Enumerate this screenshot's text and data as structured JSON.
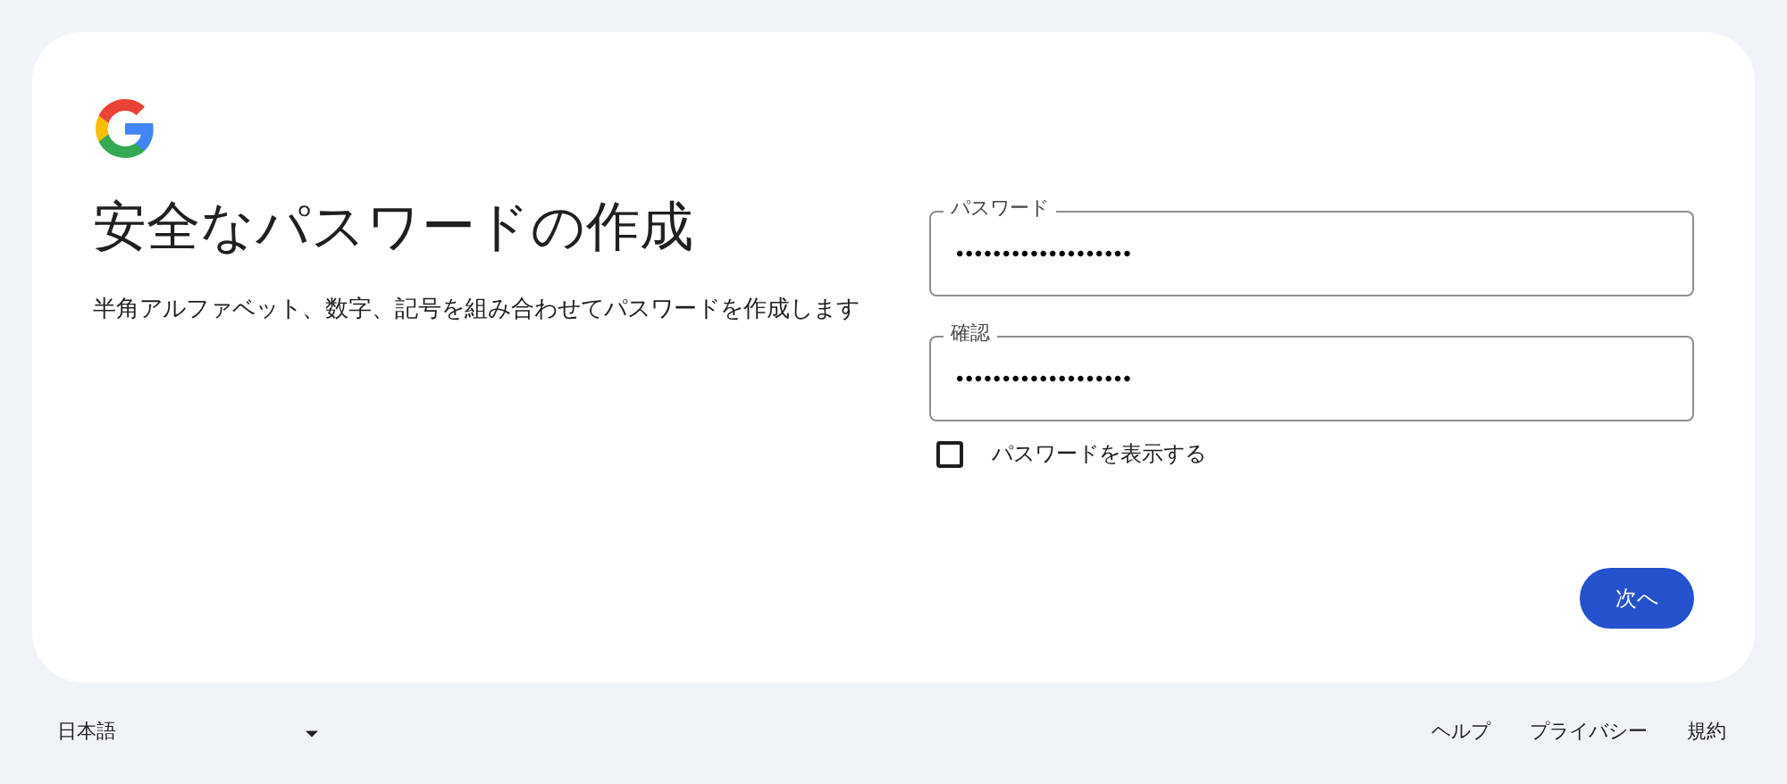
{
  "title": "安全なパスワードの作成",
  "description": "半角アルファベット、数字、記号を組み合わせてパスワードを作成します",
  "fields": [
    {
      "label": "パスワード",
      "value": "•••••••••••••••••••"
    },
    {
      "label": "確認",
      "value": "•••••••••••••••••••"
    }
  ],
  "show_password": {
    "label": "パスワードを表示する",
    "checked": false
  },
  "next_button": "次へ",
  "footer": {
    "language": "日本語",
    "links": [
      "ヘルプ",
      "プライバシー",
      "規約"
    ]
  }
}
